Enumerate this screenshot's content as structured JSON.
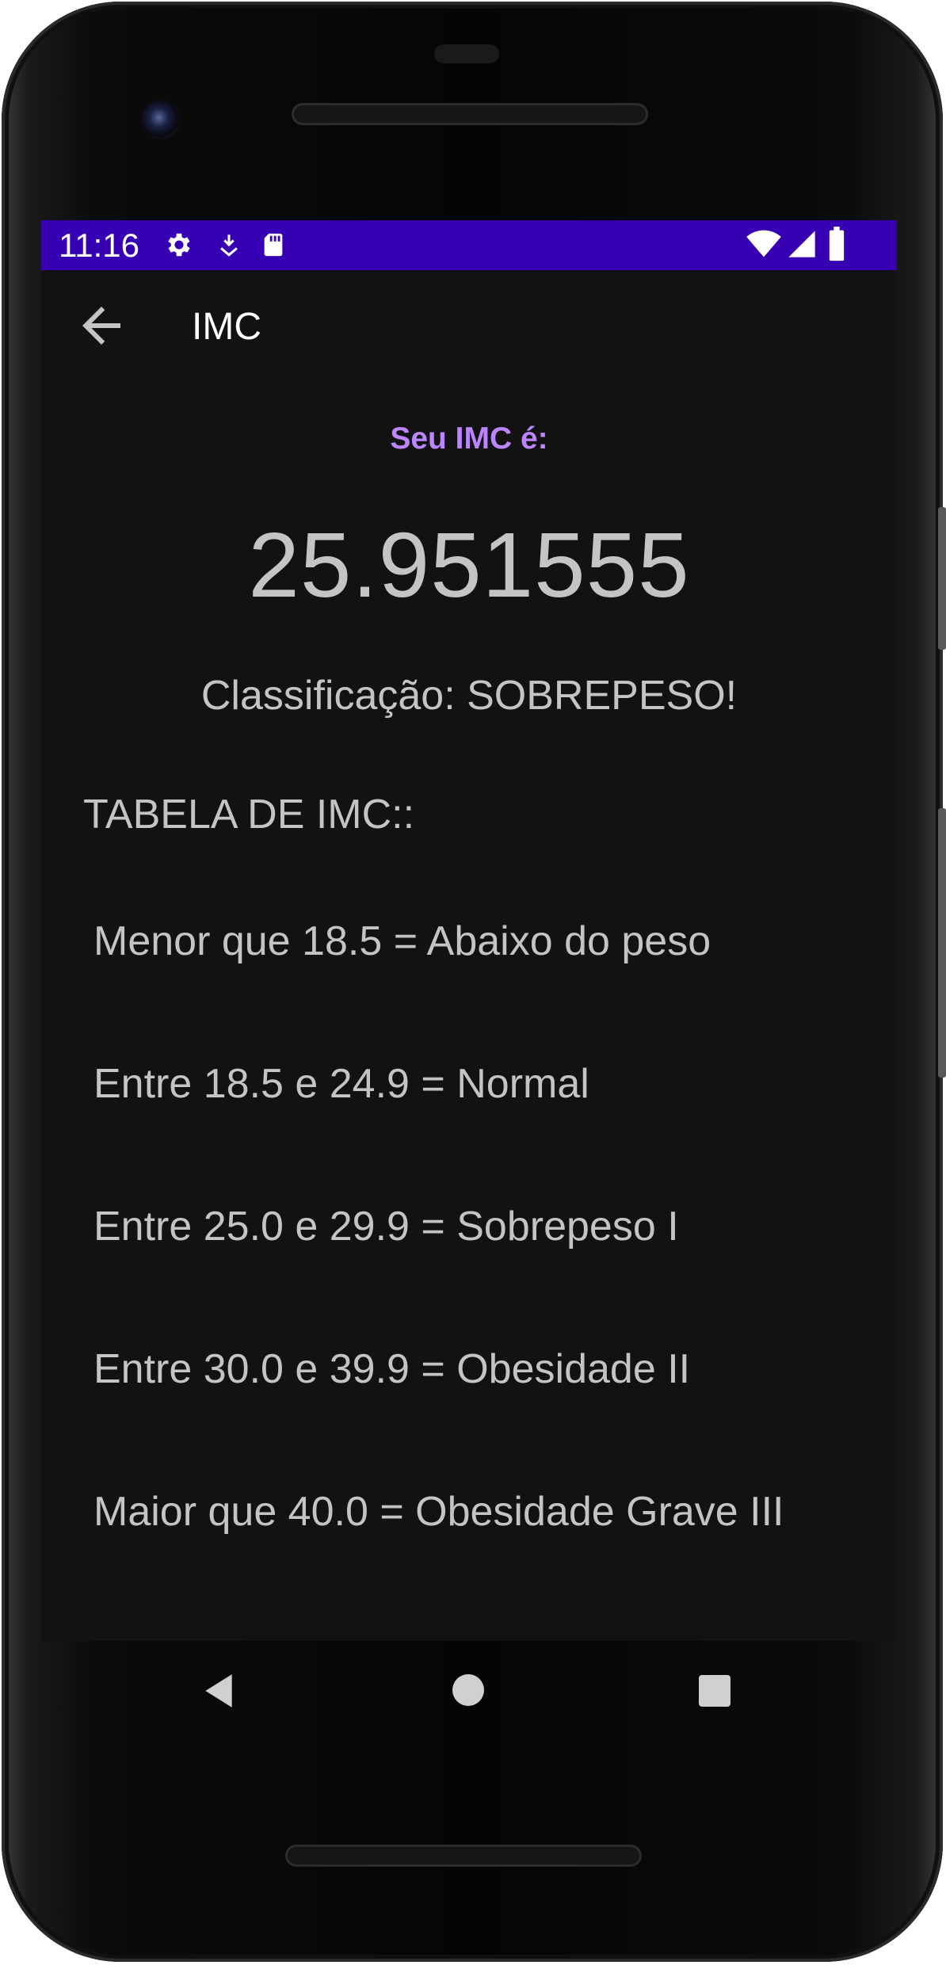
{
  "status_bar": {
    "time": "11:16",
    "icons": [
      "gear-icon",
      "download-icon",
      "sd-card-icon",
      "wifi-icon",
      "signal-icon",
      "battery-icon"
    ],
    "background_color": "#3700b3"
  },
  "app_bar": {
    "title": "IMC",
    "back_icon": "arrow-back-icon"
  },
  "result": {
    "label": "Seu IMC é:",
    "value": "25.951555",
    "classification": "Classificação: SOBREPESO!"
  },
  "table": {
    "title": "TABELA DE IMC::",
    "rows": [
      {
        "text": "Menor que 18.5 = Abaixo do peso"
      },
      {
        "text": "Entre 18.5 e 24.9 = Normal"
      },
      {
        "text": "Entre 25.0 e 29.9 = Sobrepeso I"
      },
      {
        "text": "Entre 30.0 e 39.9 = Obesidade II"
      },
      {
        "text": "Maior que 40.0 = Obesidade Grave III"
      }
    ]
  },
  "nav_bar": {
    "icons": [
      "back-triangle-icon",
      "home-circle-icon",
      "recents-square-icon"
    ]
  },
  "colors": {
    "accent": "#bb86fc",
    "screen_background": "#121212",
    "text": "#c4c4c4"
  }
}
